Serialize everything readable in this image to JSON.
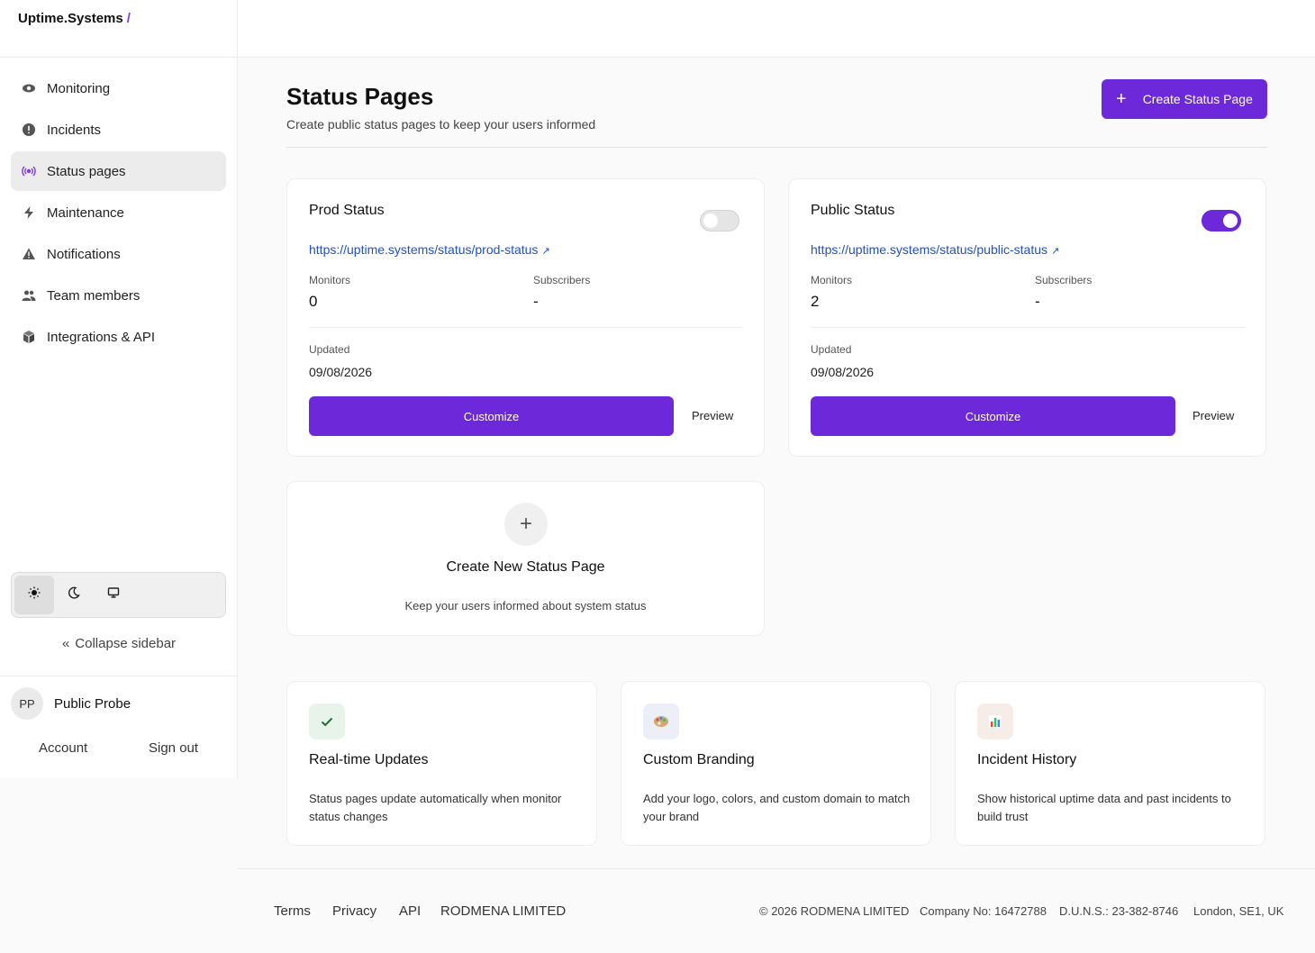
{
  "app": {
    "brand": "Uptime.Systems",
    "brand_slash": "/"
  },
  "sidebar": {
    "items": [
      {
        "label": "Monitoring",
        "icon": "eye-icon"
      },
      {
        "label": "Incidents",
        "icon": "alert-circle-icon"
      },
      {
        "label": "Status pages",
        "icon": "broadcast-icon"
      },
      {
        "label": "Maintenance",
        "icon": "bolt-icon"
      },
      {
        "label": "Notifications",
        "icon": "warning-icon"
      },
      {
        "label": "Team members",
        "icon": "users-icon"
      },
      {
        "label": "Integrations & API",
        "icon": "cube-icon"
      }
    ],
    "active": "Status pages",
    "theme_options": [
      "light",
      "dark",
      "system"
    ],
    "theme_selected": "light",
    "collapse_label": "Collapse sidebar",
    "user": {
      "initials": "PP",
      "name": "Public Probe",
      "account_label": "Account",
      "signout_label": "Sign out"
    }
  },
  "page": {
    "title": "Status Pages",
    "subtitle": "Create public status pages to keep your users informed",
    "create_button": "Create Status Page"
  },
  "status_pages": [
    {
      "name": "Prod Status",
      "url": "https://uptime.systems/status/prod-status",
      "enabled": false,
      "monitors_label": "Monitors",
      "monitors": "0",
      "subscribers_label": "Subscribers",
      "subscribers": "-",
      "updated_label": "Updated",
      "updated": "09/08/2026",
      "customize_label": "Customize",
      "preview_label": "Preview"
    },
    {
      "name": "Public Status",
      "url": "https://uptime.systems/status/public-status",
      "enabled": true,
      "monitors_label": "Monitors",
      "monitors": "2",
      "subscribers_label": "Subscribers",
      "subscribers": "-",
      "updated_label": "Updated",
      "updated": "09/08/2026",
      "customize_label": "Customize",
      "preview_label": "Preview"
    }
  ],
  "new_card": {
    "title": "Create New Status Page",
    "subtitle": "Keep your users informed about system status"
  },
  "features": [
    {
      "icon": "checkmark-icon",
      "title": "Real-time Updates",
      "desc": "Status pages update automatically when monitor status changes"
    },
    {
      "icon": "palette-icon",
      "title": "Custom Branding",
      "desc": "Add your logo, colors, and custom domain to match your brand"
    },
    {
      "icon": "bar-chart-icon",
      "title": "Incident History",
      "desc": "Show historical uptime data and past incidents to build trust"
    }
  ],
  "footer": {
    "links": [
      "Terms",
      "Privacy",
      "API",
      "RODMENA LIMITED"
    ],
    "copyright": "© 2026 RODMENA LIMITED",
    "company_no": "Company No: 16472788",
    "duns": "D.U.N.S.: 23-382-8746",
    "location": "London, SE1, UK"
  },
  "colors": {
    "accent": "#6d28d9",
    "link": "#1d4ed8"
  }
}
